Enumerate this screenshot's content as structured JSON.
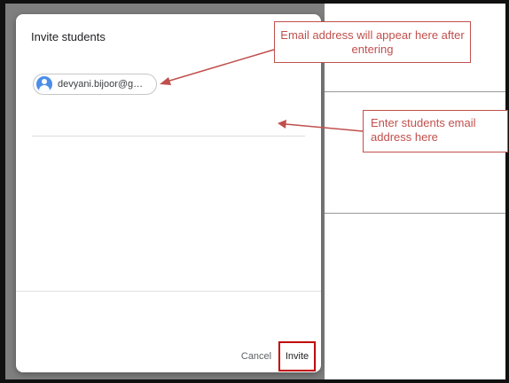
{
  "dialog": {
    "title": "Invite students",
    "chip": {
      "email": "devyani.bijoor@g…",
      "avatar_icon": "person-avatar-icon"
    },
    "buttons": {
      "cancel_label": "Cancel",
      "invite_label": "Invite"
    }
  },
  "annotations": {
    "email_appear": "Email address will appear here after entering",
    "enter_email": "Enter students email address here"
  },
  "colors": {
    "annotation": "#c0504d",
    "highlight": "#c00000",
    "avatar": "#4b8ee8",
    "backdrop": "#7f7f7f"
  }
}
